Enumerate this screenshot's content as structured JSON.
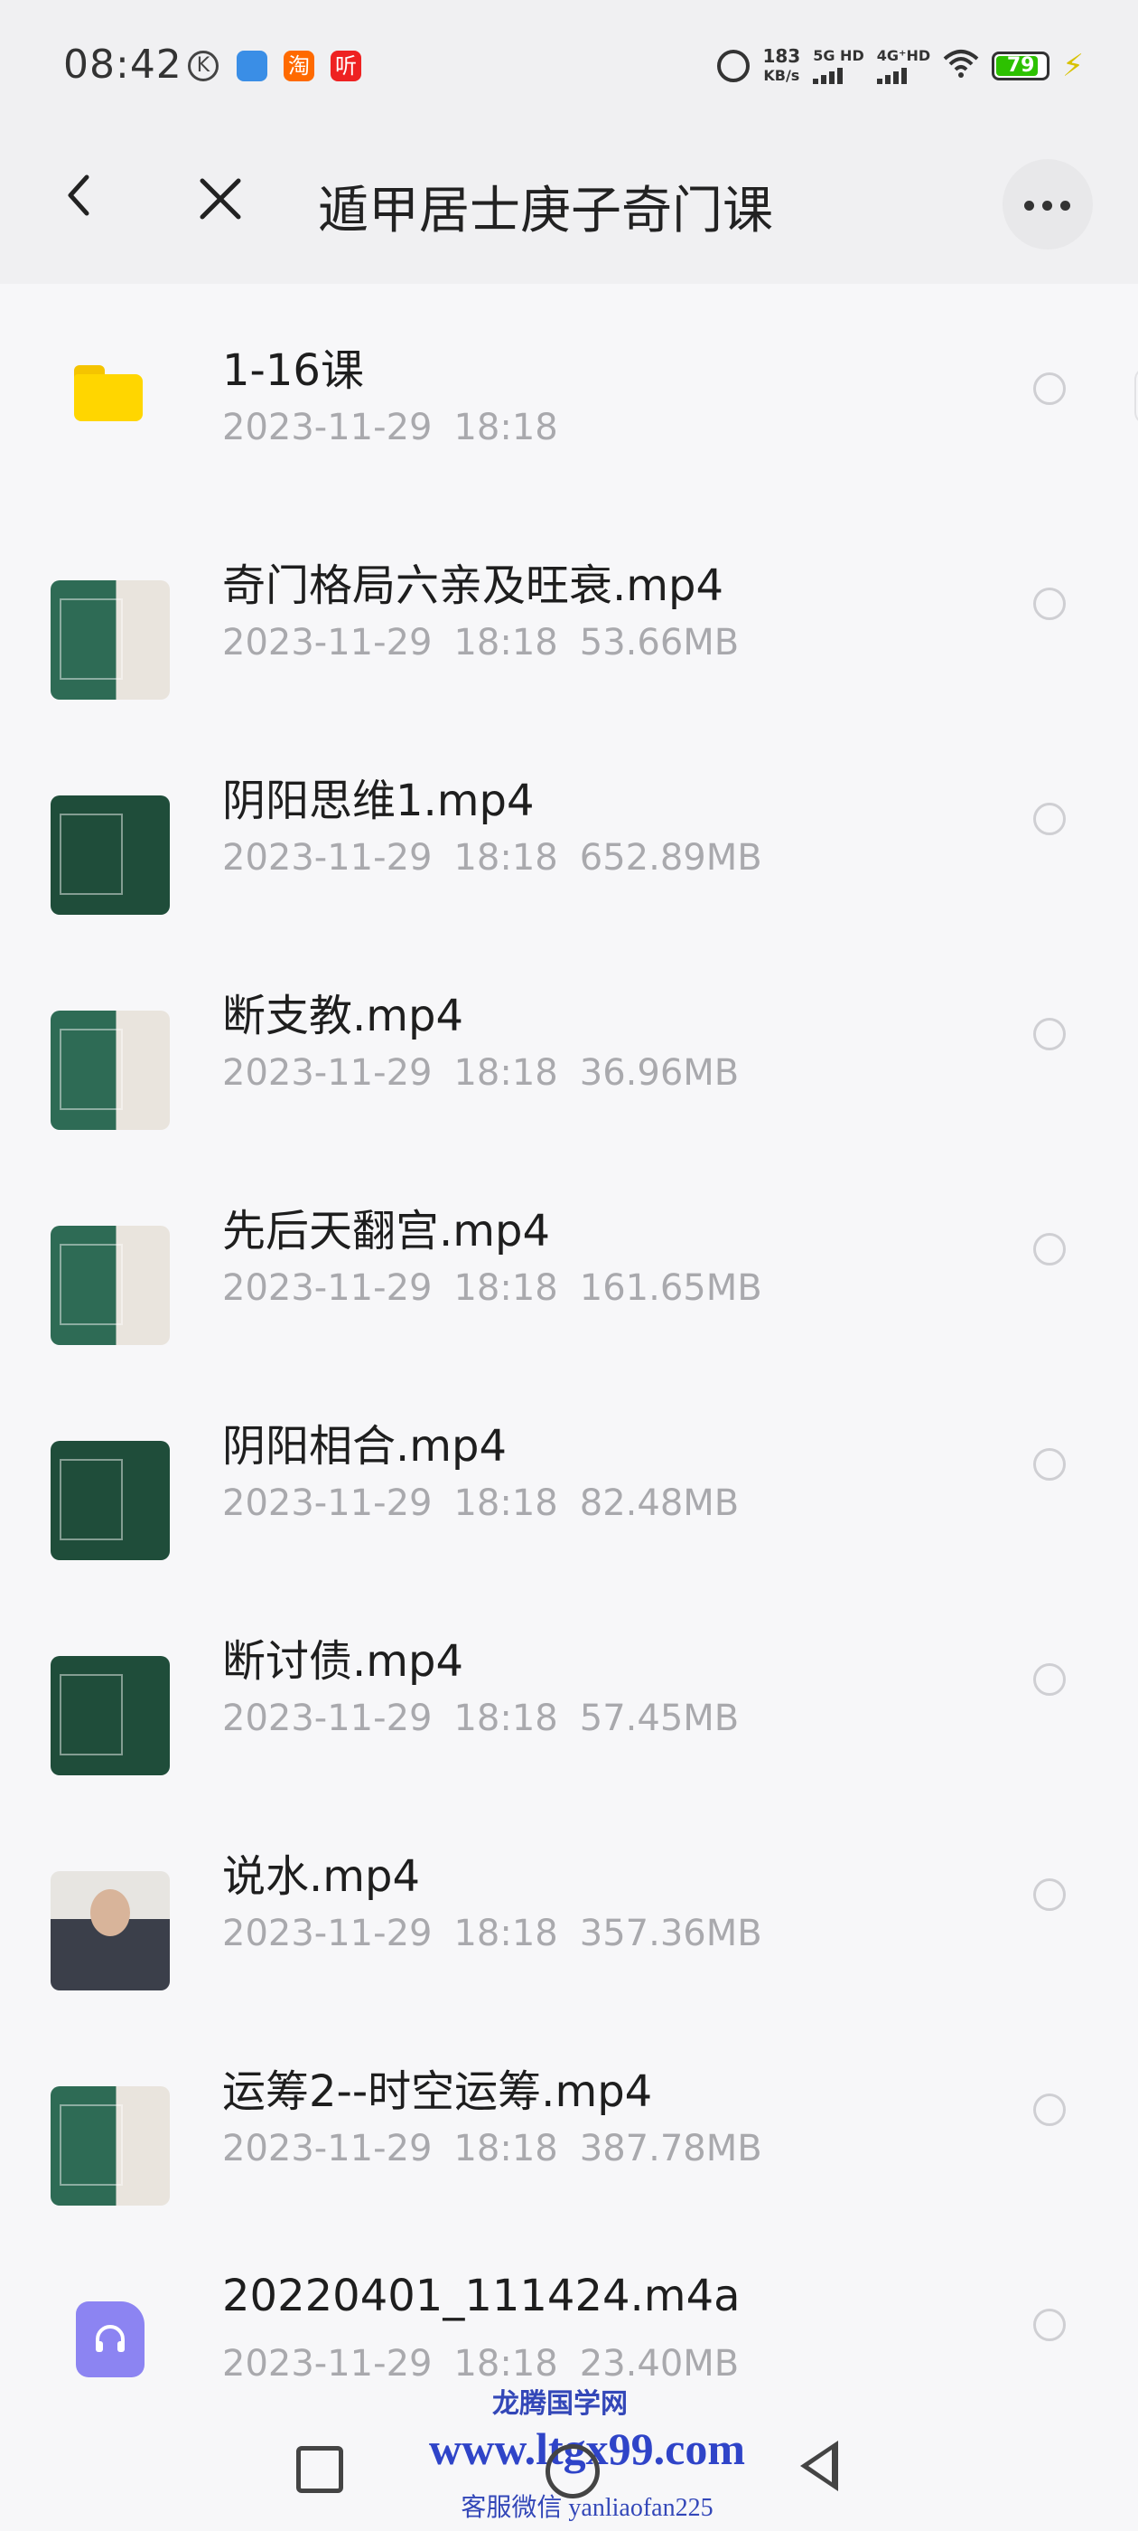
{
  "status_bar": {
    "time": "08:42",
    "net_speed_value": "183",
    "net_speed_unit": "KB/s",
    "net1": "5G HD",
    "net2": "4G⁺HD",
    "battery": "79"
  },
  "header": {
    "title": "遁甲居士庚子奇门课"
  },
  "files": [
    {
      "type": "folder",
      "name": "1-16课",
      "date": "2023-11-29",
      "time": "18:18",
      "size": ""
    },
    {
      "type": "video",
      "thumb": "photo",
      "name": "奇门格局六亲及旺衰.mp4",
      "date": "2023-11-29",
      "time": "18:18",
      "size": "53.66MB"
    },
    {
      "type": "video",
      "thumb": "board",
      "name": "阴阳思维1.mp4",
      "date": "2023-11-29",
      "time": "18:18",
      "size": "652.89MB"
    },
    {
      "type": "video",
      "thumb": "photo",
      "name": "断支教.mp4",
      "date": "2023-11-29",
      "time": "18:18",
      "size": "36.96MB"
    },
    {
      "type": "video",
      "thumb": "photo",
      "name": "先后天翻宫.mp4",
      "date": "2023-11-29",
      "time": "18:18",
      "size": "161.65MB"
    },
    {
      "type": "video",
      "thumb": "board",
      "name": "阴阳相合.mp4",
      "date": "2023-11-29",
      "time": "18:18",
      "size": "82.48MB"
    },
    {
      "type": "video",
      "thumb": "board",
      "name": "断讨债.mp4",
      "date": "2023-11-29",
      "time": "18:18",
      "size": "57.45MB"
    },
    {
      "type": "video",
      "thumb": "person",
      "name": "说水.mp4",
      "date": "2023-11-29",
      "time": "18:18",
      "size": "357.36MB"
    },
    {
      "type": "video",
      "thumb": "photo",
      "name": "运筹2--时空运筹.mp4",
      "date": "2023-11-29",
      "time": "18:18",
      "size": "387.78MB"
    },
    {
      "type": "audio",
      "name": "20220401_111424.m4a",
      "date": "2023-11-29",
      "time": "18:18",
      "size": "23.40MB"
    }
  ],
  "watermark": {
    "line1": "龙腾国学网",
    "line2": "www.ltgx99.com",
    "line3": "客服微信 yanliaofan225"
  }
}
